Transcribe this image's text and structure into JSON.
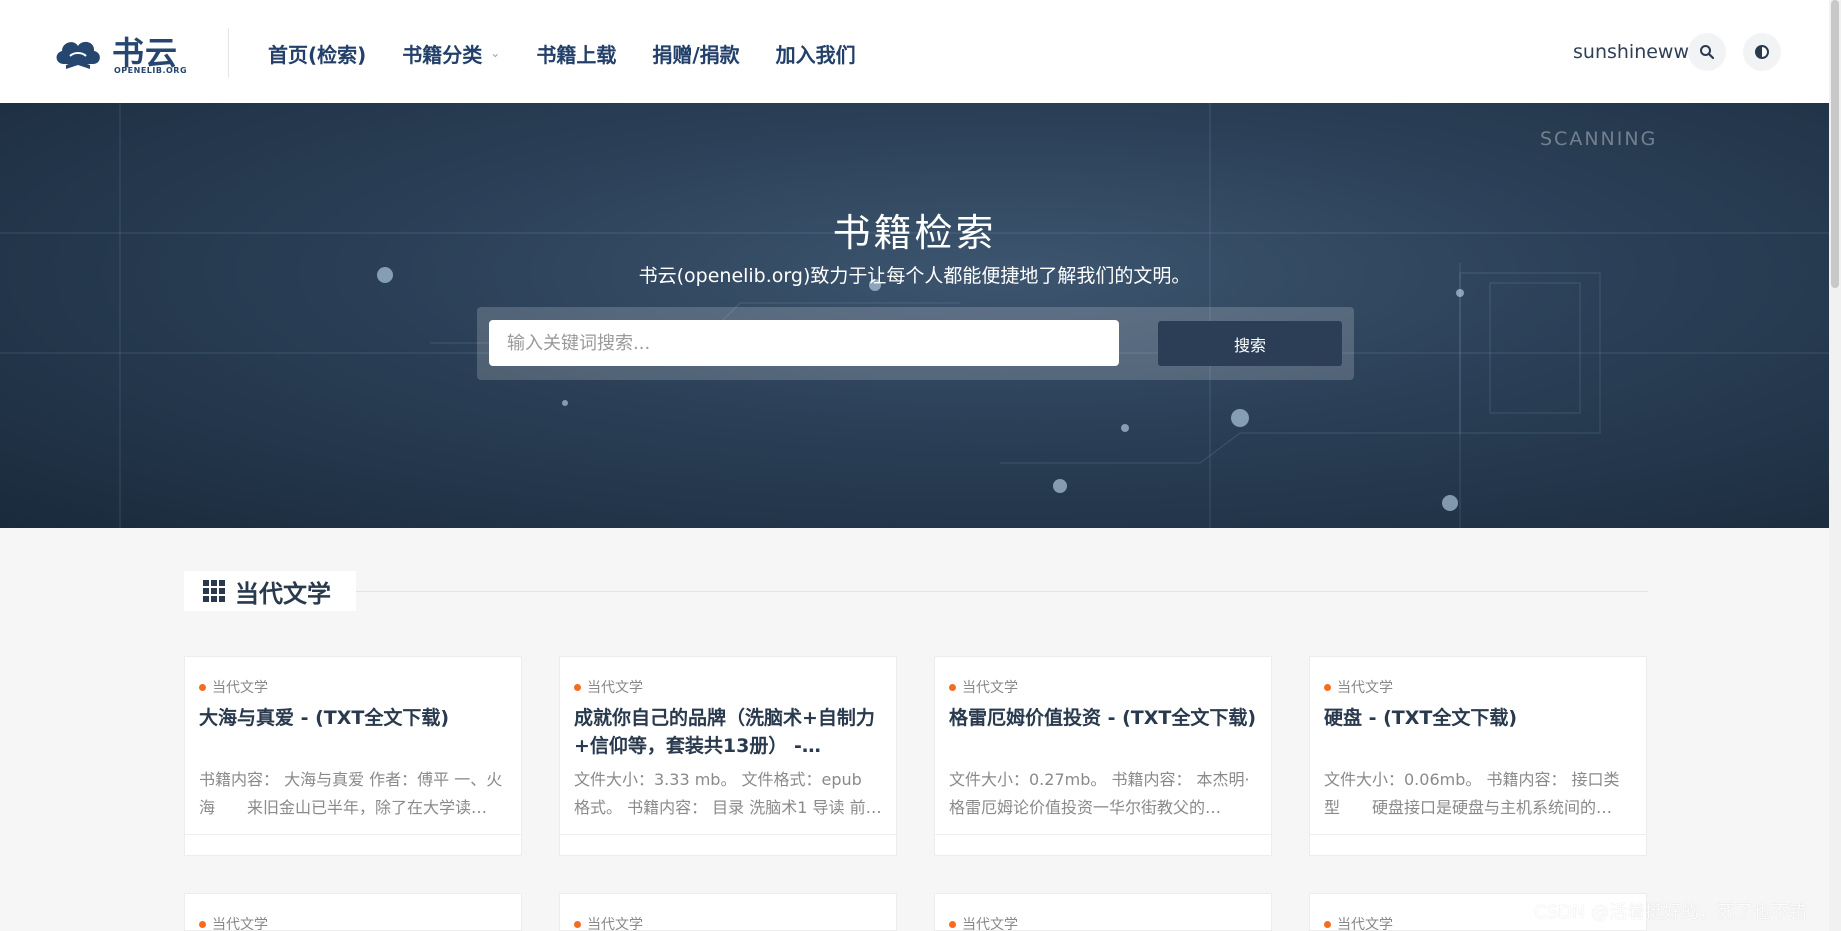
{
  "header": {
    "logo_text": "书云",
    "logo_sub": "OPENELIB.ORG",
    "nav": [
      {
        "label": "首页(检索)"
      },
      {
        "label": "书籍分类"
      },
      {
        "label": "书籍上载"
      },
      {
        "label": "捐赠/捐款"
      },
      {
        "label": "加入我们"
      }
    ],
    "username": "sunshineww",
    "icons": [
      "search-icon",
      "theme-toggle-icon"
    ]
  },
  "hero": {
    "scan_label": "SCANNING",
    "title": "书籍检索",
    "subtitle": "书云(openelib.org)致力于让每个人都能便捷地了解我们的文明。",
    "search": {
      "placeholder": "输入关键词搜索...",
      "button": "搜索"
    }
  },
  "section": {
    "title": "当代文学",
    "icon": "grid-icon"
  },
  "cards": [
    {
      "tag": "当代文学",
      "title": "大海与真爱 - (TXT全文下载)",
      "desc": "书籍内容： 大海与真爱 作者：傅平 一、火海　　来旧金山已半年，除了在大学读…"
    },
    {
      "tag": "当代文学",
      "title": "成就你自己的品牌（洗脑术+自制力+信仰等，套装共13册） - (EPUB…",
      "desc": "文件大小：3.33 mb。 文件格式：epub 格式。 书籍内容： 目录 洗脑术1 导读 前记…"
    },
    {
      "tag": "当代文学",
      "title": "格雷厄姆价值投资 - (TXT全文下载)",
      "desc": "文件大小：0.27mb。 书籍内容： 本杰明·格雷厄姆论价值投资一华尔街教父的…"
    },
    {
      "tag": "当代文学",
      "title": "硬盘 - (TXT全文下载)",
      "desc": "文件大小：0.06mb。 书籍内容： 接口类型　　硬盘接口是硬盘与主机系统间的…"
    },
    {
      "tag": "当代文学",
      "title": "",
      "desc": ""
    },
    {
      "tag": "当代文学",
      "title": "",
      "desc": ""
    },
    {
      "tag": "当代文学",
      "title": "",
      "desc": ""
    },
    {
      "tag": "当代文学",
      "title": "",
      "desc": ""
    }
  ],
  "watermark": "CSDN @活着挺好的，死了也不错"
}
